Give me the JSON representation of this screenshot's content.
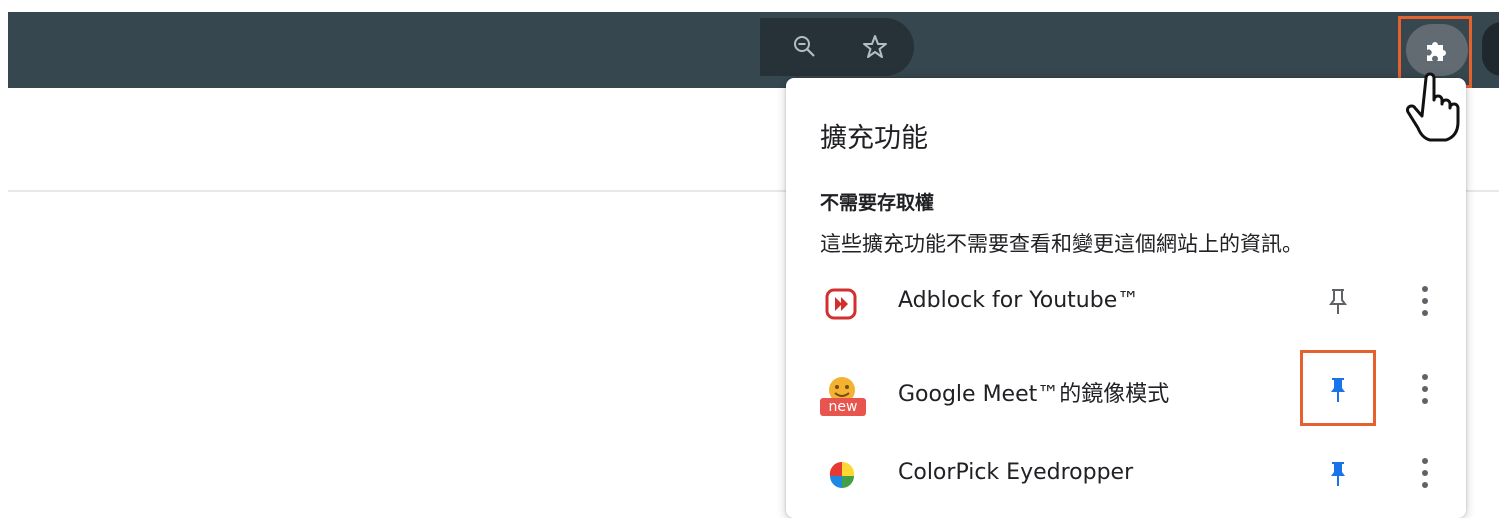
{
  "toolbar": {
    "zoom_icon": "zoom-out-icon",
    "bookmark_icon": "star-outline-icon",
    "extensions_icon": "puzzle-piece-icon",
    "cursor_icon": "hand-pointer-icon"
  },
  "panel": {
    "title": "擴充功能",
    "section_heading": "不需要存取權",
    "section_description": "這些擴充功能不需要查看和變更這個網站上的資訊。",
    "extensions": [
      {
        "name": "Adblock for Youtube™",
        "icon": "adblock-youtube-icon",
        "pinned": false
      },
      {
        "name": "Google Meet™的鏡像模式",
        "icon": "meet-mirror-icon",
        "badge": "new",
        "pinned": true
      },
      {
        "name": "ColorPick Eyedropper",
        "icon": "colorpick-icon",
        "pinned": true
      }
    ]
  },
  "colors": {
    "toolbar_bg": "#37474f",
    "omnibox_bg": "#263238",
    "highlight": "#e5612d",
    "pin_active": "#1a73e8",
    "pin_inactive": "#5f6368",
    "text": "#202124"
  }
}
